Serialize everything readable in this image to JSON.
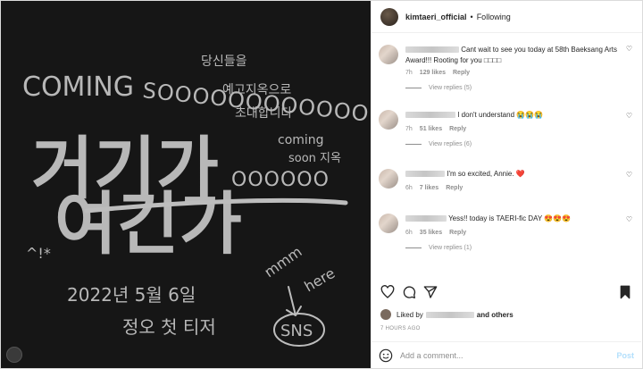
{
  "image": {
    "lines": {
      "coming": "COMING",
      "sooo": "SOOOOOOOOOOOO",
      "ooo": "OOOOOO",
      "korean_top1": "당신들을",
      "korean_top2": "예고지옥으로",
      "korean_top3": "초대합니다",
      "coming_small": "coming",
      "soon_small": "soon 지옥",
      "big_line1": "거기가",
      "big_line2": "여긴가",
      "date": "2022년 5월 6일",
      "teaser": "정오 첫 티저",
      "mmm": "mmm",
      "here": "here",
      "sns": "SNS",
      "doodle": "^!*"
    }
  },
  "header": {
    "username": "kimtaeri_official",
    "separator": "•",
    "following": "Following"
  },
  "comments": [
    {
      "text": "Cant wait to see you today at 58th Baeksang Arts Award!!! Rooting for you",
      "emoji": "□□□□",
      "time": "7h",
      "likes": "129 likes",
      "reply": "Reply",
      "view_replies": "View replies (5)"
    },
    {
      "text": "I don't understand",
      "emoji": "😭😭😭",
      "time": "7h",
      "likes": "51 likes",
      "reply": "Reply",
      "view_replies": "View replies (6)"
    },
    {
      "text": "I'm so excited, Annie.",
      "emoji": "❤️",
      "time": "6h",
      "likes": "7 likes",
      "reply": "Reply",
      "view_replies": ""
    },
    {
      "text": "Yess!! today is TAERI-fic DAY",
      "emoji": "😍😍😍",
      "time": "6h",
      "likes": "35 likes",
      "reply": "Reply",
      "view_replies": "View replies (1)"
    }
  ],
  "likes": {
    "prefix": "Liked by",
    "and_others": "and others"
  },
  "time_ago": "7 HOURS AGO",
  "add_comment": {
    "placeholder": "Add a comment...",
    "post_label": "Post"
  },
  "colors": {
    "post_button": "#b2dffc",
    "meta": "#8e8e8e",
    "image_bg": "#161616",
    "chalk": "#bdbdbd"
  }
}
